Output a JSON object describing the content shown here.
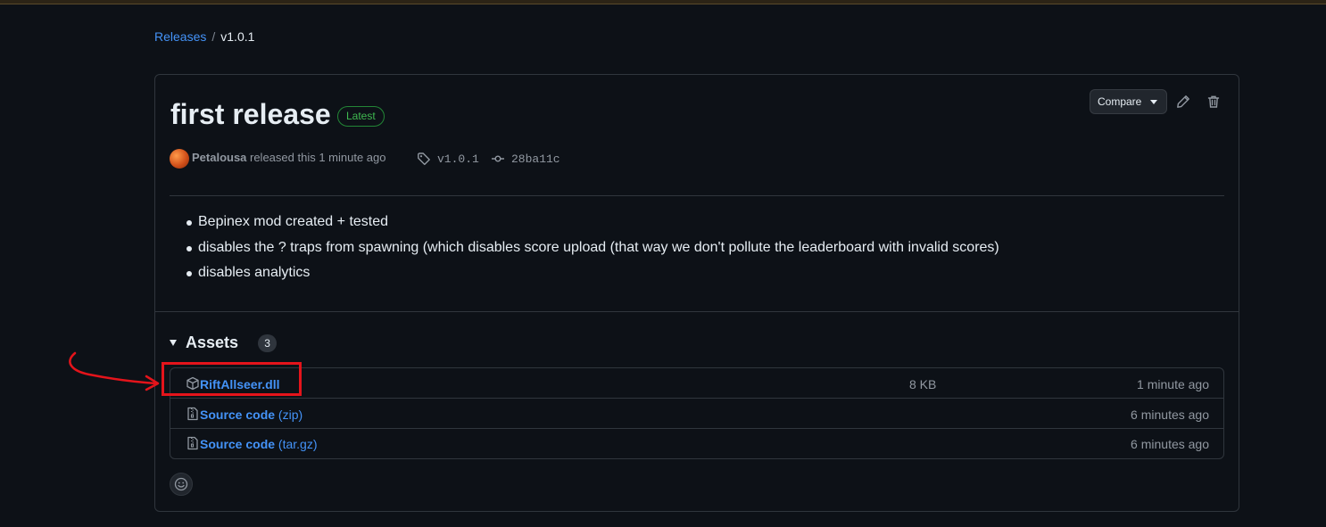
{
  "breadcrumb": {
    "parent": "Releases",
    "separator": "/",
    "current": "v1.0.1"
  },
  "release": {
    "title": "first release",
    "badge": "Latest",
    "author": "Petalousa",
    "released_text": "released this 1 minute ago",
    "tag": "v1.0.1",
    "commit": "28ba11c",
    "notes": [
      "Bepinex mod created + tested",
      "disables the ? traps from spawning (which disables score upload (that way we don't pollute the leaderboard with invalid scores)",
      "disables analytics"
    ]
  },
  "toolbar": {
    "compare_label": "Compare"
  },
  "assets": {
    "title": "Assets",
    "count": "3",
    "items": [
      {
        "name": "RiftAllseer.dll",
        "suffix": "",
        "size": "8 KB",
        "time": "1 minute ago"
      },
      {
        "name": "Source code",
        "suffix": "(zip)",
        "size": "",
        "time": "6 minutes ago"
      },
      {
        "name": "Source code",
        "suffix": "(tar.gz)",
        "size": "",
        "time": "6 minutes ago"
      }
    ]
  },
  "icons": {
    "tag": "tag-icon",
    "commit": "git-commit-icon",
    "edit": "pencil-icon",
    "delete": "trash-icon",
    "package": "package-icon",
    "zip": "file-zip-icon",
    "reaction": "smiley-icon"
  },
  "colors": {
    "background": "#0d1117",
    "link": "#4493f8",
    "latest": "#3fb950",
    "annotation": "#e4141b"
  }
}
